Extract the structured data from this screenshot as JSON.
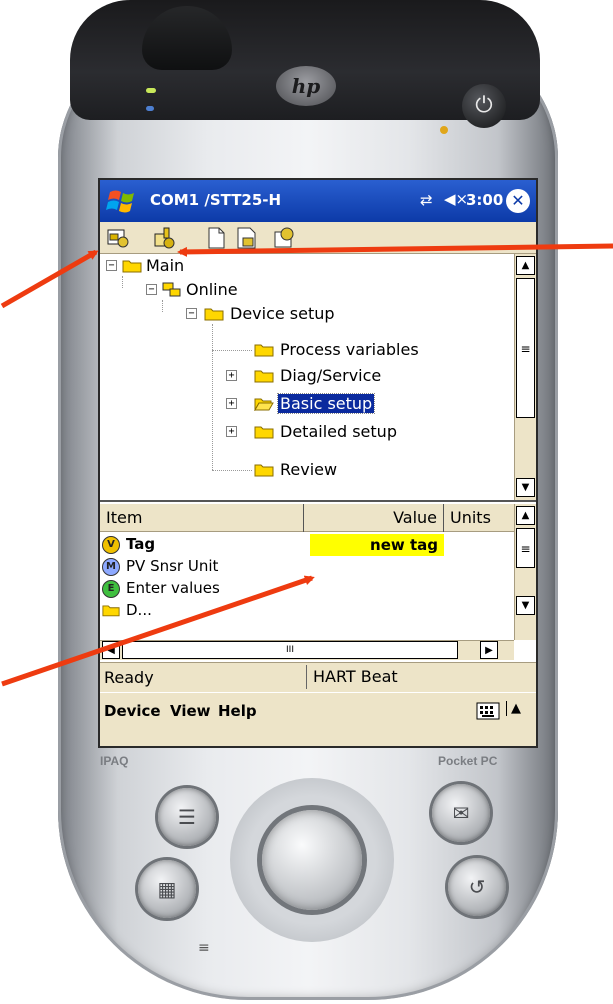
{
  "device": {
    "brand_left": "IPAQ",
    "brand_right": "Pocket PC",
    "logo": "hp"
  },
  "titlebar": {
    "title": "COM1 /STT25-H",
    "time": "3:00",
    "icons": [
      "windows-start-icon",
      "connectivity-icon",
      "speaker-muted-icon",
      "close-icon"
    ]
  },
  "toolbar": {
    "buttons": [
      "connect-icon",
      "device-online-icon",
      "new-document-icon",
      "save-icon",
      "properties-icon"
    ]
  },
  "tree": {
    "items": [
      {
        "label": "Main",
        "expanded": true
      },
      {
        "label": "Online",
        "expanded": true
      },
      {
        "label": "Device setup",
        "expanded": true
      },
      {
        "label": "Process variables"
      },
      {
        "label": "Diag/Service",
        "expanded": false
      },
      {
        "label": "Basic setup",
        "expanded": false,
        "selected": true
      },
      {
        "label": "Detailed setup",
        "expanded": false
      },
      {
        "label": "Review"
      }
    ]
  },
  "grid": {
    "columns": [
      "Item",
      "Value",
      "Units"
    ],
    "rows": [
      {
        "icon": "V",
        "item": "Tag",
        "value": "new tag",
        "highlight": "#ffff00"
      },
      {
        "icon": "M",
        "item": "PV Snsr Unit",
        "value": ""
      },
      {
        "icon": "E",
        "item": "Enter values",
        "value": ""
      },
      {
        "icon": "folder",
        "item": "D...",
        "value": ""
      }
    ],
    "hscroll_mark": "III"
  },
  "status": {
    "left": "Ready",
    "right": "HART Beat"
  },
  "menubar": {
    "items": [
      "Device",
      "View",
      "Help"
    ]
  },
  "colors": {
    "title_bar": "#0c3aa8",
    "chrome": "#ede4c8",
    "selection": "#0a2a9e",
    "highlight": "#ffff00",
    "arrow": "#ee3b10"
  }
}
